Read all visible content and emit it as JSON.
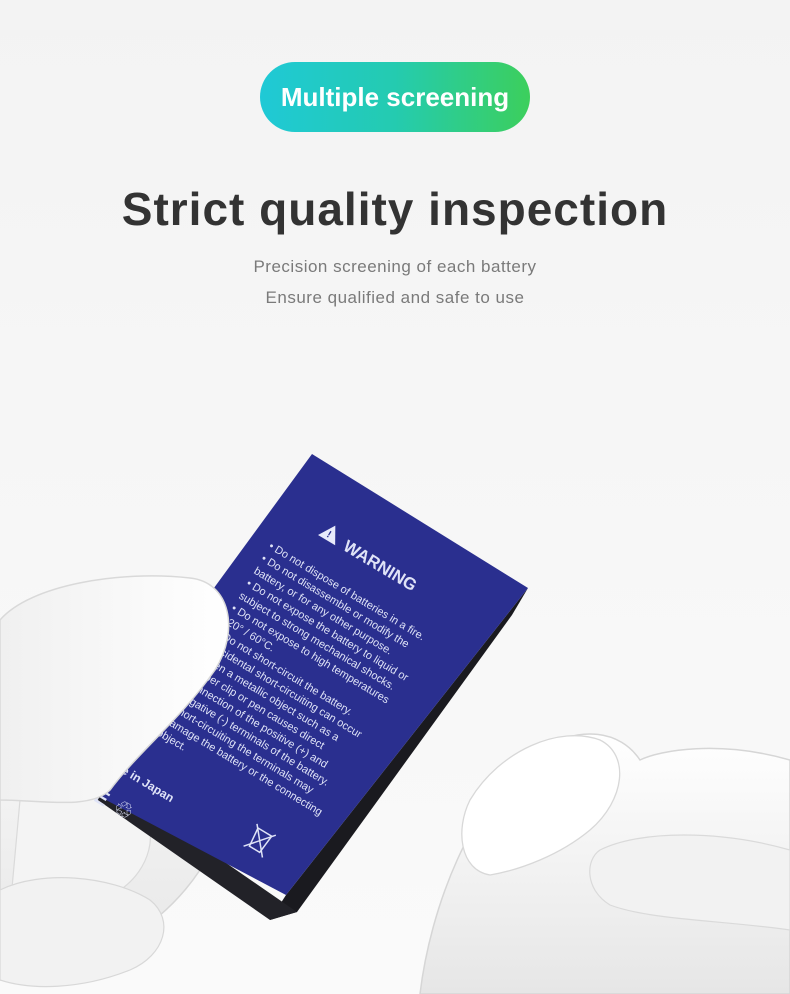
{
  "badge": {
    "label": "Multiple screening"
  },
  "heading": "Strict quality inspection",
  "subtitle": {
    "line1": "Precision screening of each battery",
    "line2": "Ensure qualified and safe to use"
  },
  "battery_label": {
    "warning_title": "WARNING",
    "lines": [
      "• Do not dispose of batteries in a fire.",
      "• Do not disassemble or modify the",
      "battery, or for any other purpose.",
      "• Do not expose the battery to liquid or",
      "subject to strong mechanical shocks.",
      "• Do not expose to high temperatures",
      "-20° / 60°C.",
      "• Do not short-circuit the battery.",
      "Accidental short-circuiting can occur",
      "when a metallic object such as a",
      "paper clip or pen causes direct",
      "connection of the positive (+) and",
      "negative (-) terminals of the battery.",
      "Short-circuiting the terminals may",
      "damage the battery or the connecting",
      "object."
    ],
    "made_in": "Made in Japan",
    "marks": [
      "CE",
      "♲"
    ]
  },
  "colors": {
    "pill_start": "#1fc9d6",
    "pill_end": "#3ccf5c",
    "battery_blue": "#2a2f8f",
    "heading": "#333333",
    "subtitle": "#7a7a7a"
  }
}
